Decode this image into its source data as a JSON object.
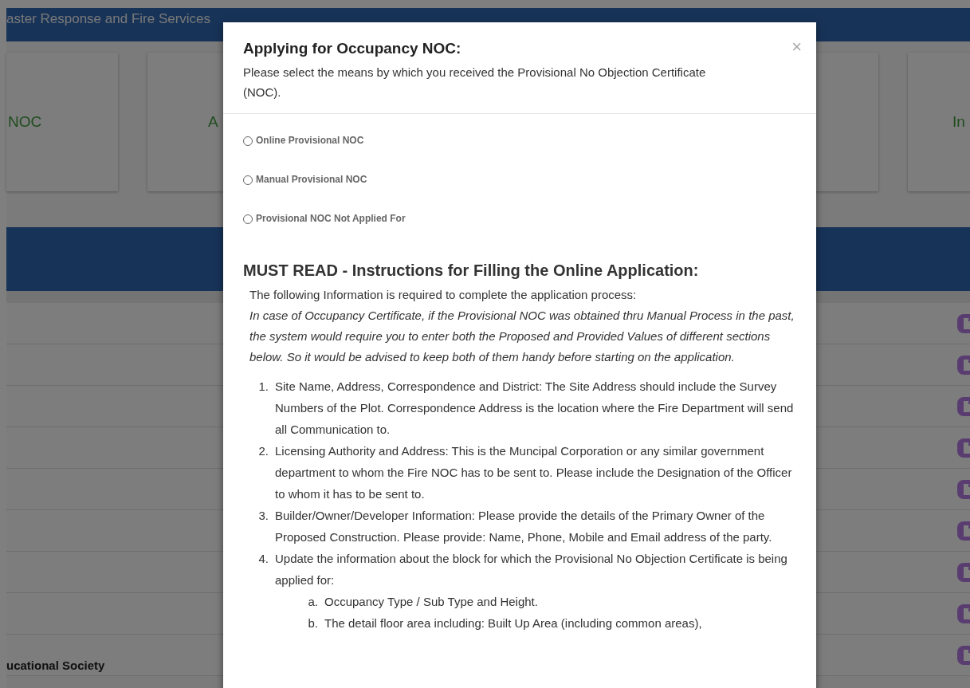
{
  "page": {
    "header_title": "aster Response and Fire Services",
    "cards": [
      {
        "kind": "titled",
        "label": "NOC"
      },
      {
        "kind": "titled",
        "label": "A"
      },
      {
        "kind": "blank"
      },
      {
        "kind": "titled",
        "label": "In"
      }
    ],
    "rows": [
      {
        "text": ""
      },
      {
        "text": ""
      },
      {
        "text": ""
      },
      {
        "text": ""
      },
      {
        "text": ""
      },
      {
        "text": ""
      },
      {
        "text": ""
      },
      {
        "text": ""
      },
      {
        "text": "ucational Society"
      }
    ]
  },
  "modal": {
    "title": "Applying for Occupancy NOC:",
    "subtitle": "Please select the means by which you received the Provisional No Objection Certificate (NOC).",
    "close": "×",
    "options": [
      {
        "label": "Online Provisional NOC",
        "selected": false
      },
      {
        "label": "Manual Provisional NOC",
        "selected": false
      },
      {
        "label": "Provisional NOC Not Applied For",
        "selected": false
      }
    ],
    "heading": "MUST READ - Instructions for Filling the Online Application:",
    "intro": "The following Information is required to complete the application process:",
    "note": "In case of Occupancy Certificate, if the Provisional NOC was obtained thru Manual Process in the past, the system would require you to enter both the Proposed and Provided Values of different sections below. So it would be advised to keep both of them handy before starting on the application.",
    "steps": [
      {
        "number": "1.",
        "text": "Site Name, Address, Correspondence and District: The Site Address should include the Survey Numbers of the Plot. Correspondence Address is the location where the Fire Department will send all Communication to."
      },
      {
        "number": "2.",
        "text": "Licensing Authority and Address: This is the Muncipal Corporation or any similar government department to whom the Fire NOC has to be sent to. Please include the Designation of the Officer to whom it has to be sent to."
      },
      {
        "number": "3.",
        "text": "Builder/Owner/Developer Information: Please provide the details of the Primary Owner of the Proposed Construction. Please provide: Name, Phone, Mobile and Email address of the party."
      },
      {
        "number": "4.",
        "text": "Update the information about the block for which the Provisional No Objection Certificate is being applied for:",
        "children": [
          {
            "number": "a.",
            "text": "Occupancy Type / Sub Type and Height."
          },
          {
            "number": "b.",
            "text": "The detail floor area including: Built Up Area (including common areas),"
          }
        ]
      }
    ]
  }
}
